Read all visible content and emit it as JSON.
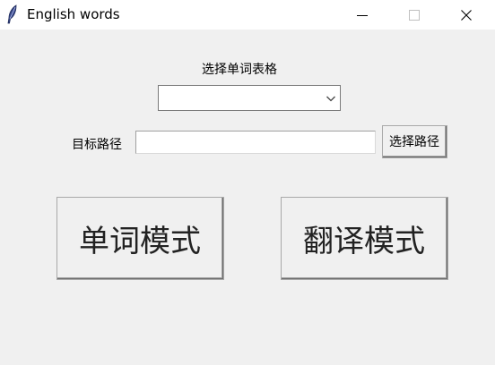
{
  "window": {
    "title": "English words",
    "icons": {
      "app": "feather-icon",
      "minimize": "minimize-icon",
      "maximize": "maximize-icon",
      "close": "close-icon"
    }
  },
  "form": {
    "select_table_label": "选择单词表格",
    "table_select_value": "",
    "target_path_label": "目标路径",
    "target_path_value": "",
    "choose_path_button": "选择路径"
  },
  "modes": {
    "word_mode_button": "单词模式",
    "translate_mode_button": "翻译模式"
  },
  "colors": {
    "window_bg": "#f0f0f0",
    "titlebar_bg": "#ffffff",
    "field_bg": "#ffffff"
  }
}
